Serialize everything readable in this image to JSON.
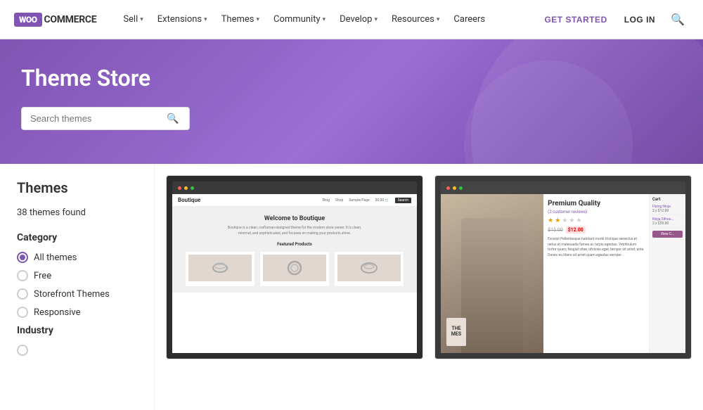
{
  "nav": {
    "logo_box": "WOO",
    "logo_text": "COMMERCE",
    "links": [
      {
        "label": "Sell",
        "has_dropdown": true
      },
      {
        "label": "Extensions",
        "has_dropdown": true
      },
      {
        "label": "Themes",
        "has_dropdown": true
      },
      {
        "label": "Community",
        "has_dropdown": true
      },
      {
        "label": "Develop",
        "has_dropdown": true
      },
      {
        "label": "Resources",
        "has_dropdown": true
      },
      {
        "label": "Careers",
        "has_dropdown": false
      }
    ],
    "get_started": "GET STARTED",
    "login": "LOG IN"
  },
  "hero": {
    "title": "Theme Store",
    "search_placeholder": "Search themes"
  },
  "sidebar": {
    "themes_heading": "Themes",
    "themes_count": "38 themes found",
    "category_label": "Category",
    "categories": [
      {
        "label": "All themes",
        "selected": true
      },
      {
        "label": "Free",
        "selected": false
      },
      {
        "label": "Storefront Themes",
        "selected": false
      },
      {
        "label": "Responsive",
        "selected": false
      }
    ],
    "industry_label": "Industry"
  },
  "themes": [
    {
      "name": "Boutique",
      "type": "boutique"
    },
    {
      "name": "Premium Quality",
      "type": "premium",
      "reviews": "(2 customer reviews)",
      "old_price": "$15.00",
      "new_price": "$12.00",
      "description": "Excerpt Pellentesque habitant morbi tristique senectus et netus et malesuada fames ac turpis egestas. Vestibulum tortor quam, feugiat vitae, ultricies eget, tempor sit amet, ante. Donec eu libero sit amet quam egestas semper.",
      "cart_title": "Cart",
      "cart_item1_name": "Flying Ninja",
      "cart_item1_detail": "2 x $12.00",
      "cart_item2_name": "Ninja Silhou...",
      "cart_item2_detail": "2 x $35.00",
      "view_cart": "View C..."
    }
  ]
}
